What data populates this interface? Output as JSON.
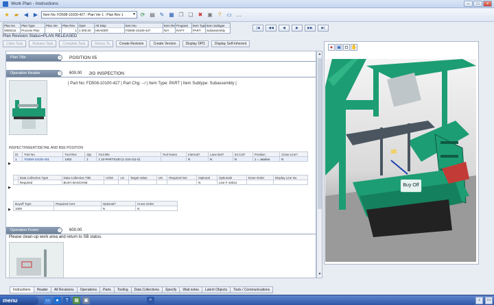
{
  "window": {
    "title": "Work Plan - Instructions"
  },
  "toolbar": {
    "combo1": "Item No: FD508-10100-427 ; Plan Ver 1 ; Plan Rev 1",
    "combo2": ""
  },
  "header_grid": {
    "columns": [
      {
        "label": "Plan No",
        "value": "0000242"
      },
      {
        "label": "Plan Type",
        "value": "Process Plan"
      },
      {
        "label": "Plan Ver",
        "value": "1"
      },
      {
        "label": "Plan Rev",
        "value": "1"
      },
      {
        "label": "Oper",
        "value": "1 000.00"
      },
      {
        "label": "Alt Step",
        "value": "HEADER"
      },
      {
        "label": "Item No",
        "value": "FD508-10100-427"
      },
      {
        "label": "Item Rev",
        "value": "N/A"
      },
      {
        "label": "Program",
        "value": "RAFT"
      },
      {
        "label": "Item Type",
        "value": "PART"
      },
      {
        "label": "Item Subtype",
        "value": "Subassembly"
      }
    ]
  },
  "nav_buttons": [
    "|◀",
    "◀◀",
    "◀",
    "▶",
    "▶▶",
    "▶|"
  ],
  "status": {
    "text": "Plan Revision Status=PLAN RELEASED"
  },
  "actions": [
    {
      "label": "Claim Task",
      "disabled": true
    },
    {
      "label": "Release Task",
      "disabled": true
    },
    {
      "label": "Complete Task",
      "disabled": true
    },
    {
      "label": "Return To",
      "disabled": true
    },
    {
      "label": "Create Revision",
      "disabled": false
    },
    {
      "label": "Create Version",
      "disabled": false
    },
    {
      "label": "Display DPD",
      "disabled": false
    },
    {
      "label": "Display Self-Inherent",
      "disabled": false
    }
  ],
  "plan_title": {
    "tag": "Plan Title",
    "value": "POSITION 05"
  },
  "operation_header": {
    "tag": "Operation Header",
    "number": "600.00",
    "name": "JIG INSPECTION",
    "part_info": "| Part No: FD508-10100-427 | Part Chg: --/ | Item Type: PART | Item Subtype: Subassembly |"
  },
  "inspect_label": "INSPECT/INSERT/DETAIL AND BSE POSITION",
  "table1": {
    "headers": [
      "ID",
      "Part No",
      "Tool Rev",
      "Qty",
      "Tool title",
      "Tool Notes",
      "Internal?",
      "Lane Bal?",
      "Int Cal?",
      "Position",
      "Close Line?"
    ],
    "row": [
      "1",
      "FD500-10100-401",
      "1002",
      "1",
      "1 10-PARTS100 (1-210-211-0)",
      "",
      "N",
      "N",
      "N",
      "1 = Jawline",
      "N"
    ]
  },
  "table2": {
    "headers": [
      "",
      "Data Collection Type",
      "Data Collection Title",
      "UOM",
      "LS",
      "Target Value",
      "US",
      "Required Set",
      "Optional",
      "Optional2",
      "Done Order",
      "Display Line No"
    ],
    "row": [
      "",
      "Required",
      "BUSY BASCHNE",
      "",
      "",
      "",
      "",
      "",
      "N",
      "Line F 10012",
      "",
      ""
    ]
  },
  "table3": {
    "headers": [
      "Buyoff Type",
      "Required Cert",
      "Optional?",
      "Cross Order"
    ],
    "row": [
      "1000",
      "",
      "N",
      "N"
    ]
  },
  "operation_footer": {
    "tag": "Operation Footer",
    "number": "600.00",
    "note": "Please clean-up work area and return to SB status."
  },
  "tabs": [
    "Instructions",
    "Header",
    "All Revisions",
    "Operations",
    "Parts",
    "Tooling",
    "Data Collections",
    "Specify",
    "Wait notes",
    "Latent Objects",
    "Tools / Communications"
  ],
  "viewer": {
    "callout": "Buy Off"
  },
  "taskbar": {
    "start": "menu"
  },
  "colors": {
    "accent": "#2e57a6",
    "model_green": "#18a878",
    "callout_border": "#2a9d7a"
  }
}
